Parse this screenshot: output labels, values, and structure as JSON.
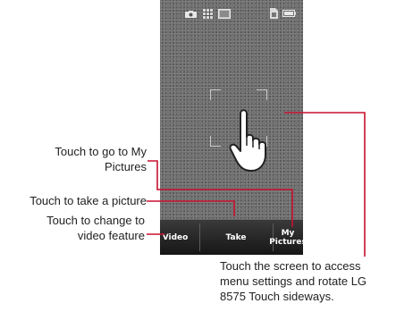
{
  "softkeys": {
    "video": "Video",
    "take": "Take",
    "my_pictures_line1": "My",
    "my_pictures_line2": "Pictures"
  },
  "callouts": {
    "my_pictures_line1": "Touch to go to My",
    "my_pictures_line2": "Pictures",
    "take": "Touch to take a picture",
    "video_line1": "Touch to change to",
    "video_line2": "video feature",
    "screen_line1": "Touch the screen to access",
    "screen_line2": "menu settings and rotate LG",
    "screen_line3": "8575 Touch sideways."
  },
  "colors": {
    "leader_line": "#c8102e",
    "screen_bg": "#6b6b6b",
    "softkey_bar": "#1e1e1e"
  },
  "icons": [
    "camera-icon",
    "grid-icon",
    "image-icon",
    "memory-card-icon",
    "battery-icon",
    "hand-pointer-icon",
    "focus-frame-icon"
  ]
}
